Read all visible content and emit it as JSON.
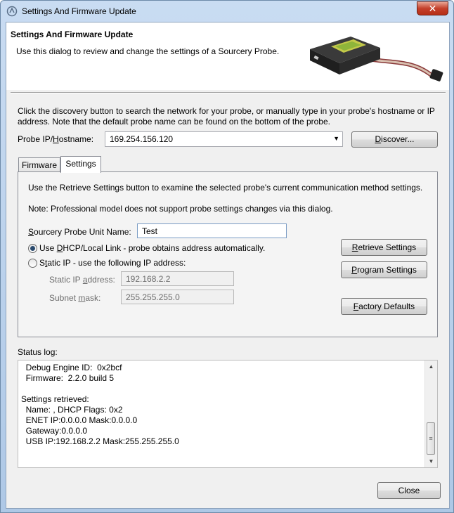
{
  "window": {
    "title": "Settings And Firmware Update",
    "close_glyph": "✕"
  },
  "header": {
    "title": "Settings And Firmware Update",
    "description": "Use this dialog to review and change the settings of a Sourcery Probe."
  },
  "intro": "Click the discovery button to search the network for your probe, or manually type in your probe's hostname or IP address. Note that the default probe name can be found on the bottom of the probe.",
  "probe": {
    "label_pre": "Probe IP/",
    "label_access": "H",
    "label_post": "ostname:",
    "value": "169.254.156.120",
    "discover_access": "D",
    "discover_rest": "iscover..."
  },
  "tabs": [
    {
      "label": "Firmware",
      "active": false
    },
    {
      "label": "Settings",
      "active": true
    }
  ],
  "settings": {
    "instructions": "Use the Retrieve Settings button to examine the selected probe's current communication method settings.",
    "note": "Note: Professional model does not support probe settings changes via this dialog.",
    "unit_name_label_access": "S",
    "unit_name_label_rest": "ourcery Probe Unit Name:",
    "unit_name_value": "Test",
    "dhcp_label_pre": "Use ",
    "dhcp_label_access": "D",
    "dhcp_label_post": "HCP/Local Link - probe obtains address automatically.",
    "static_label_pre": "S",
    "static_label_access": "t",
    "static_label_post": "atic IP - use the following IP address:",
    "static_ip_label_pre": "Static IP ",
    "static_ip_label_access": "a",
    "static_ip_label_post": "ddress:",
    "static_ip_value": "192.168.2.2",
    "subnet_label_pre": "Subnet ",
    "subnet_label_access": "m",
    "subnet_label_post": "ask:",
    "subnet_value": "255.255.255.0",
    "selected_mode": "dhcp",
    "retrieve_access": "R",
    "retrieve_rest": "etrieve Settings",
    "program_access": "P",
    "program_rest": "rogram Settings",
    "factory_access": "F",
    "factory_rest": "actory Defaults"
  },
  "status_log": {
    "label": "Status log:",
    "lines": [
      "  Debug Engine ID:  0x2bcf",
      "  Firmware:  2.2.0 build 5",
      "",
      "Settings retrieved:",
      "  Name: , DHCP Flags: 0x2",
      "  ENET IP:0.0.0.0 Mask:0.0.0.0",
      "  Gateway:0.0.0.0",
      "  USB IP:192.168.2.2 Mask:255.255.255.0"
    ]
  },
  "footer": {
    "close_label": "Close"
  }
}
